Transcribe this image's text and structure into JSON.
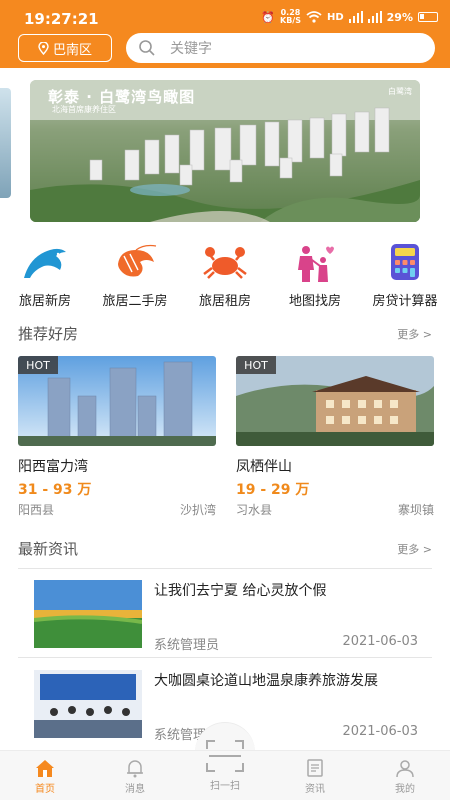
{
  "status": {
    "time": "19:27:21",
    "net_speed": "0.28",
    "net_unit": "KB/S",
    "battery": "29%"
  },
  "header": {
    "location": "巴南区",
    "search_placeholder": "关键字"
  },
  "banner": {
    "title": "彰泰 · 白鹭湾鸟瞰图",
    "subtitle": "北海首席康养住区",
    "logo": "白鹭湾"
  },
  "categories": [
    {
      "label": "旅居新房",
      "icon": "dolphin-icon"
    },
    {
      "label": "旅居二手房",
      "icon": "shrimp-icon"
    },
    {
      "label": "旅居租房",
      "icon": "crab-icon"
    },
    {
      "label": "地图找房",
      "icon": "family-icon"
    },
    {
      "label": "房贷计算器",
      "icon": "calculator-icon"
    }
  ],
  "recommended": {
    "title": "推荐好房",
    "more": "更多 >",
    "items": [
      {
        "badge": "HOT",
        "name": "阳西富力湾",
        "price": "31 - 93 万",
        "county": "阳西县",
        "town": "沙扒湾"
      },
      {
        "badge": "HOT",
        "name": "凤栖伴山",
        "price": "19 - 29 万",
        "county": "习水县",
        "town": "寨坝镇"
      }
    ]
  },
  "news": {
    "title": "最新资讯",
    "more": "更多 >",
    "items": [
      {
        "title": "让我们去宁夏 给心灵放个假",
        "author": "系统管理员",
        "date": "2021-06-03"
      },
      {
        "title": "大咖圆桌论道山地温泉康养旅游发展",
        "author": "系统管理员",
        "date": "2021-06-03"
      }
    ]
  },
  "nav": {
    "items": [
      {
        "label": "首页",
        "icon": "home-icon",
        "active": true
      },
      {
        "label": "消息",
        "icon": "bell-icon"
      },
      {
        "label": "扫一扫",
        "icon": "scan-icon"
      },
      {
        "label": "资讯",
        "icon": "news-icon"
      },
      {
        "label": "我的",
        "icon": "user-icon"
      }
    ]
  },
  "colors": {
    "brand": "#f5891f",
    "price": "#f08a1c"
  }
}
